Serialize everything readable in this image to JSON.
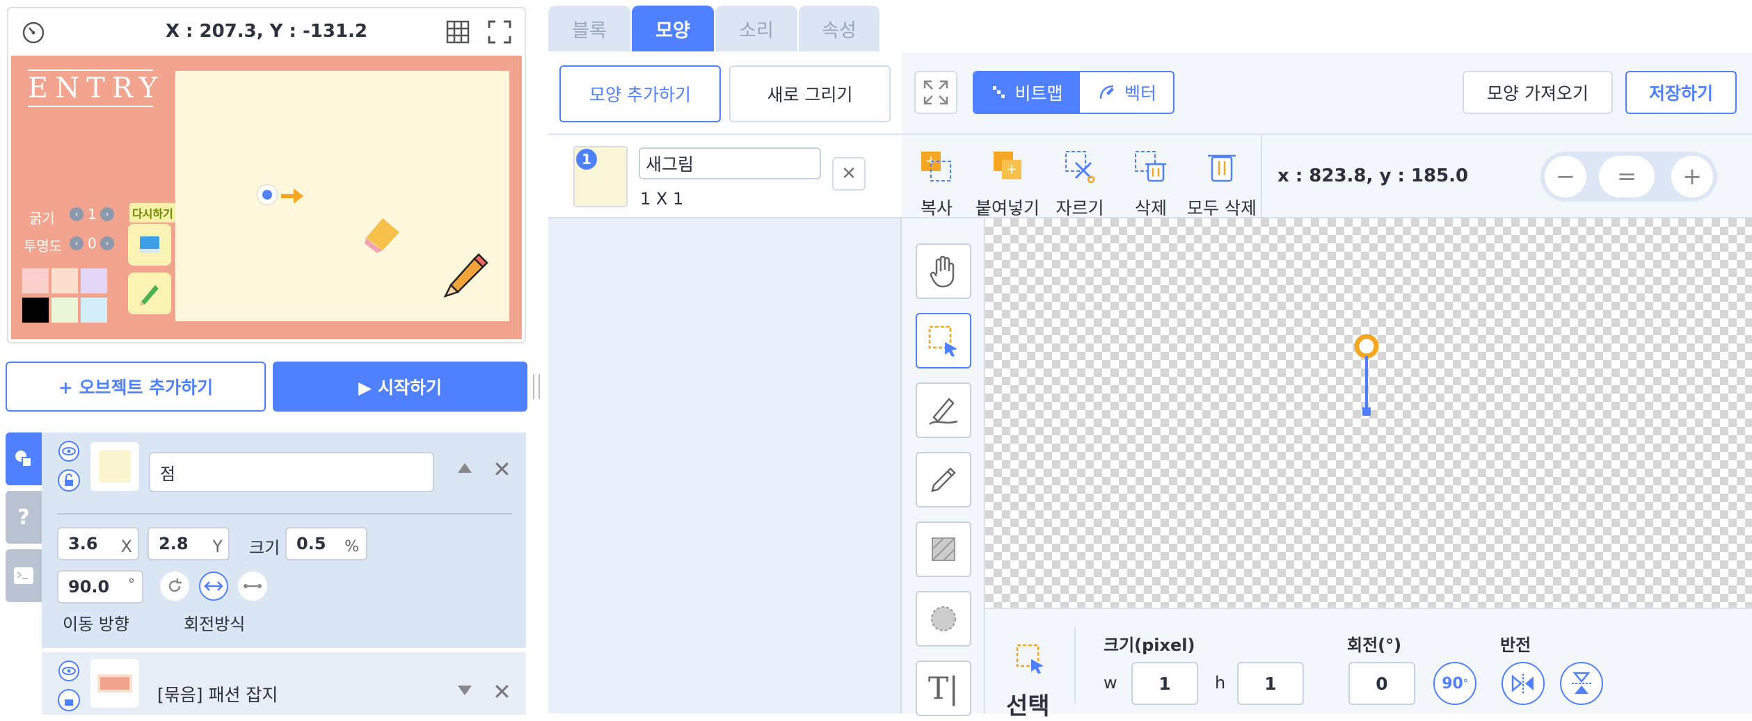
{
  "stage": {
    "coord": "X : 207.3, Y : -131.2",
    "logo_text": "ENTRY",
    "thickness_label": "굵기",
    "thickness_value": "1",
    "opacity_label": "투명도",
    "opacity_value": "0",
    "reset_label": "다시하기",
    "palette": [
      "#f9cfcb",
      "#fbe1cd",
      "#e3d6f6",
      "#000000",
      "#e9f7d8",
      "#d4eef8"
    ]
  },
  "buttons": {
    "add_object": "+ 오브젝트 추가하기",
    "start": "▶ 시작하기"
  },
  "object": {
    "name": "점",
    "x": "3.6",
    "x_unit": "X",
    "y": "2.8",
    "y_unit": "Y",
    "size_label": "크기",
    "size": "0.5",
    "size_unit": "%",
    "direction": "90.0",
    "direction_unit": "°",
    "move_dir_label": "이동 방향",
    "rotation_label": "회전방식",
    "next_name": "[묶음] 패션 잡지"
  },
  "tabs": [
    "블록",
    "모양",
    "소리",
    "속성"
  ],
  "shape_list": {
    "add_label": "모양 추가하기",
    "draw_label": "새로 그리기",
    "item": {
      "index": "1",
      "name": "새그림",
      "size": "1 X 1"
    }
  },
  "editor": {
    "bitmap_label": "비트맵",
    "vector_label": "벡터",
    "import_label": "모양 가져오기",
    "save_label": "저장하기",
    "tools": [
      "복사",
      "붙여넣기",
      "자르기",
      "삭제",
      "모두 삭제"
    ],
    "cursor_coord": "x : 823.8, y : 185.0",
    "zoom_out": "−",
    "zoom_reset": "=",
    "zoom_in": "+",
    "size_title": "크기(pixel)",
    "w_label": "w",
    "w_value": "1",
    "h_label": "h",
    "h_value": "1",
    "rotate_title": "회전(°)",
    "rotate_value": "0",
    "rotate_90": "90",
    "flip_title": "반전",
    "select_label": "선택"
  },
  "colors": {
    "accent": "#4f80ff",
    "stage_bg": "#f3a48e",
    "canvas_bg": "#fff8dd",
    "panel_bg": "#dbe6f4"
  }
}
